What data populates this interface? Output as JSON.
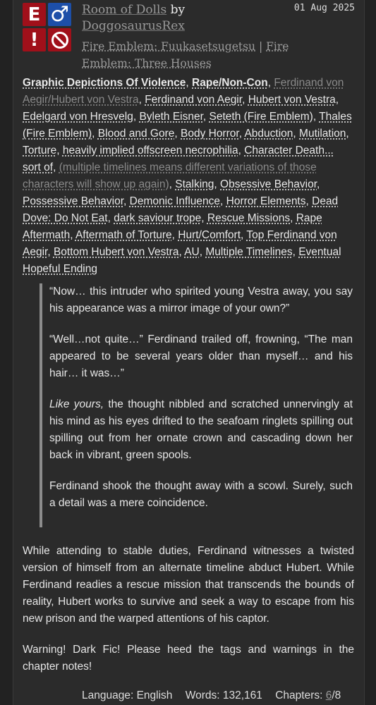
{
  "work": {
    "title": "Room of Dolls",
    "by": "by",
    "author": "DoggosaurusRex",
    "fandom_1": "Fire Emblem: Fuukasetsugetsu",
    "separator": " | ",
    "fandom_2": "Fire Emblem: Three Houses",
    "date": "01 Aug 2025"
  },
  "icons": {
    "rating": {
      "glyph": "E",
      "name": "explicit-rating-icon"
    },
    "category": {
      "glyph": "♂",
      "name": "male-male-category-icon"
    },
    "warnings": {
      "glyph": "!",
      "name": "archive-warnings-icon"
    },
    "status": {
      "glyph": "⃠",
      "name": "work-in-progress-icon"
    }
  },
  "tags": {
    "warnings": [
      "Graphic Depictions Of Violence",
      "Rape/Non-Con"
    ],
    "relationships": [
      "Ferdinand von Aegir/Hubert von Vestra"
    ],
    "characters": [
      "Ferdinand von Aegir",
      "Hubert von Vestra",
      "Edelgard von Hresvelg",
      "Byleth Eisner",
      "Seteth (Fire Emblem)",
      "Thales (Fire Emblem)"
    ],
    "freeforms_a": [
      "Blood and Gore",
      "Body Horror",
      "Abduction",
      "Mutilation",
      "Torture",
      "heavily implied offscreen necrophilia",
      "Character Death... sort of"
    ],
    "freeform_gray": "(multiple timelines means different variations of those characters will show up again)",
    "freeforms_b": [
      "Stalking",
      "Obsessive Behavior",
      "Possessive Behavior",
      "Demonic Influence",
      "Horror Elements",
      "Dead Dove: Do Not Eat",
      "dark saviour trope",
      "Rescue Missions",
      "Rape Aftermath",
      "Aftermath of Torture",
      "Hurt/Comfort",
      "Top Ferdinand von Aegir",
      "Bottom Hubert von Vestra",
      "AU",
      "Multiple Timelines",
      "Eventual Hopeful Ending"
    ]
  },
  "quote": {
    "p1": "“Now… this intruder who spirited young Vestra away, you say his appearance was a mirror image of your own?”",
    "p2": "“Well…not quite…” Ferdinand trailed off, frowning, “The man appeared to be several years older than myself… and his hair… it was…”",
    "p3_italic": "Like yours,",
    "p3_rest": " the thought nibbled and scratched unnervingly at his mind as his eyes drifted to the seafoam ringlets spilling out spilling out from her ornate crown and cascading down her back in vibrant, green spools.",
    "p4": "Ferdinand shook the thought away with a scowl. Surely, such a detail was a mere coincidence."
  },
  "summary": {
    "p1": "While attending to stable duties, Ferdinand witnesses a twisted version of himself from an alternate timeline abduct Hubert. While Ferdinand readies a rescue mission that transcends the bounds of reality, Hubert works to survive and seek a way to escape from his new prison and the warped attentions of his captor.",
    "p2": "Warning! Dark Fic! Please heed the tags and warnings in the chapter notes!"
  },
  "stats": {
    "language_label": "Language:",
    "language": "English",
    "words_label": "Words:",
    "words": "132,161",
    "chapters_label": "Chapters:",
    "chapters_posted": "6",
    "chapters_total": "/8"
  }
}
